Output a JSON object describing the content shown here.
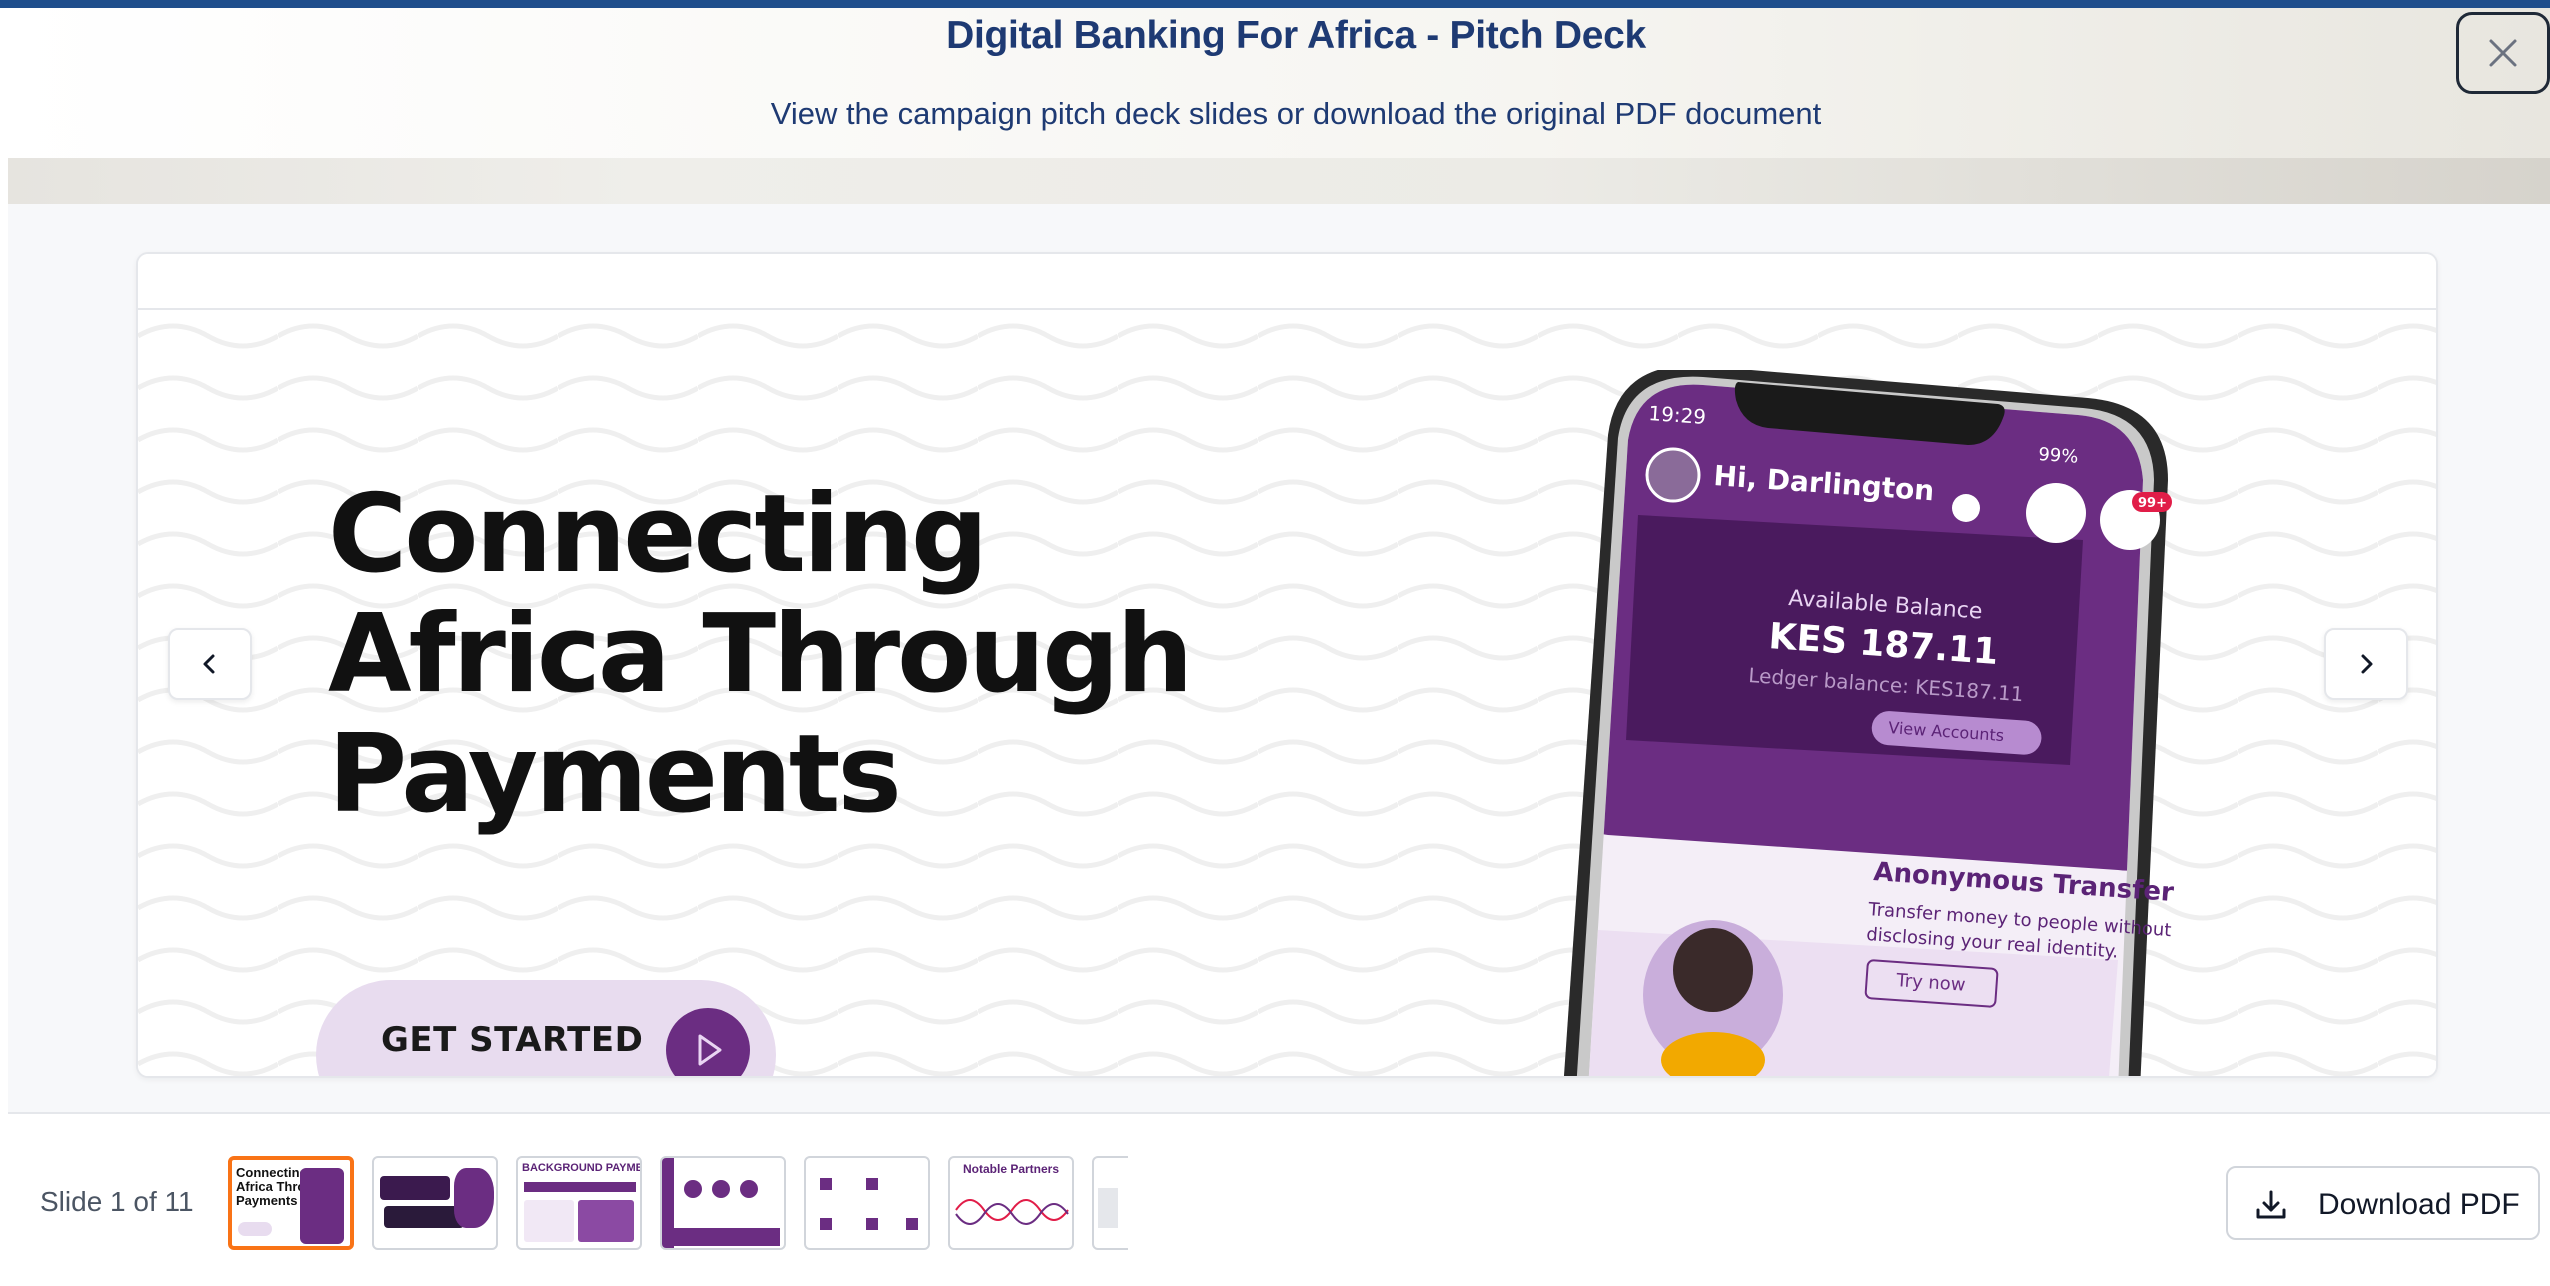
{
  "modal": {
    "title": "Digital Banking For Africa - Pitch Deck",
    "subtitle": "View the campaign pitch deck slides or download the original PDF document",
    "close_icon": "close-icon"
  },
  "slide": {
    "headline_lines": [
      "Connecting",
      "Africa Through",
      "Payments"
    ],
    "cta_label": "GET STARTED",
    "phone": {
      "time": "19:29",
      "battery": "99%",
      "greeting": "Hi, Darlington",
      "notification_badge": "99+",
      "balance_label": "Available Balance",
      "balance_value": "KES 187.11",
      "ledger_label": "Ledger balance: KES187.11",
      "view_accounts": "View Accounts",
      "card_title": "Anonymous Transfer",
      "card_text_1": "Transfer money to people without",
      "card_text_2": "disclosing your real identity.",
      "card_button": "Try now"
    }
  },
  "navigation": {
    "prev_icon": "chevron-left-icon",
    "next_icon": "chevron-right-icon"
  },
  "footer": {
    "slide_counter": "Slide 1 of 11",
    "download_label": "Download PDF",
    "download_icon": "download-icon",
    "thumbnails": [
      {
        "index": 1,
        "lines": [
          "Connecting",
          "Africa Through",
          "Payments"
        ],
        "active": true
      },
      {
        "index": 2,
        "title": "",
        "active": false
      },
      {
        "index": 3,
        "title": "BACKGROUND PAYMENTS",
        "active": false
      },
      {
        "index": 4,
        "title": "",
        "active": false
      },
      {
        "index": 5,
        "title": "",
        "active": false
      },
      {
        "index": 6,
        "title": "Notable Partners",
        "active": false
      },
      {
        "index": 7,
        "title": "",
        "active": false
      }
    ]
  },
  "colors": {
    "title_blue": "#1e3a73",
    "brand_purple": "#6b2d82",
    "active_thumb": "#f97316",
    "accent_bar": "#1f4e8c"
  }
}
